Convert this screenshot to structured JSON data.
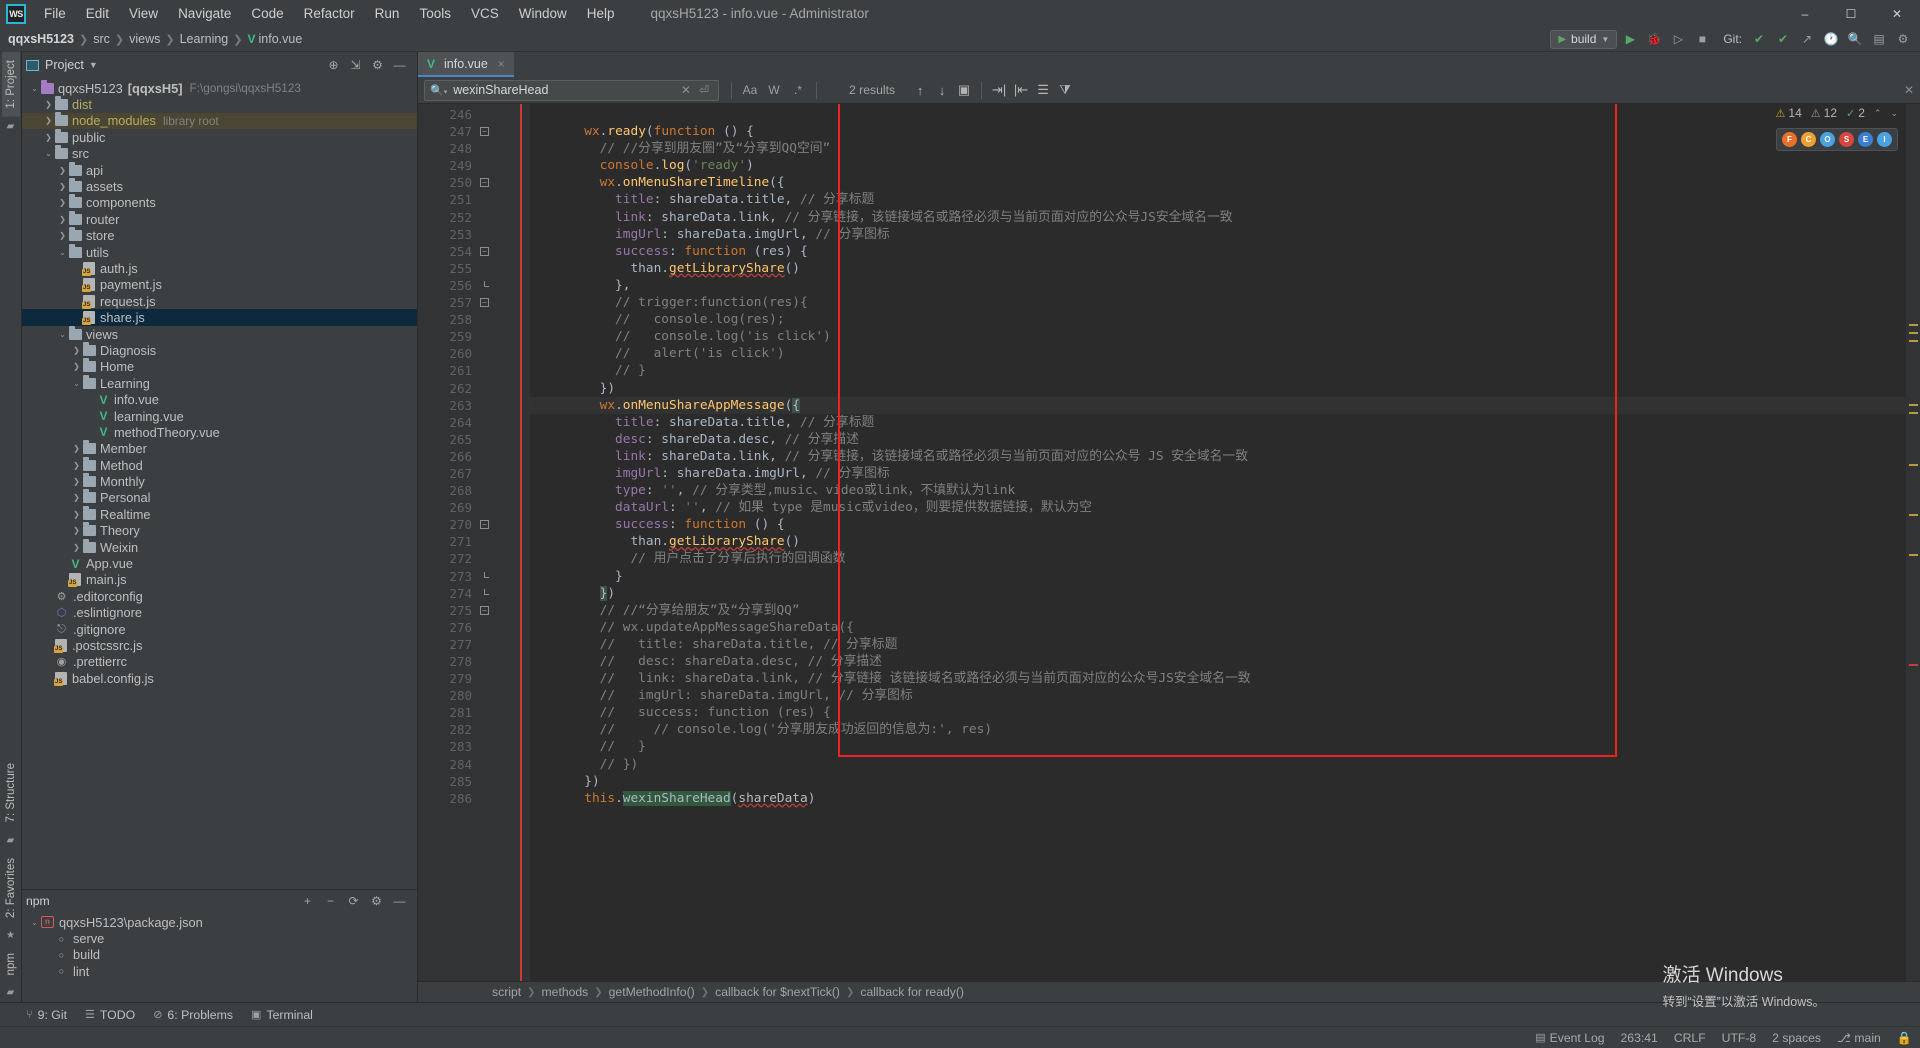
{
  "titlebar": {
    "logo": "WS",
    "title": "qqxsH5123 - info.vue - Administrator",
    "menus": [
      "File",
      "Edit",
      "View",
      "Navigate",
      "Code",
      "Refactor",
      "Run",
      "Tools",
      "VCS",
      "Window",
      "Help"
    ],
    "minimize": "–",
    "maximize": "☐",
    "close": "✕"
  },
  "navbar": {
    "crumbs": [
      "qqxsH5123",
      "src",
      "views",
      "Learning",
      "info.vue"
    ],
    "run_config": "build",
    "git_label": "Git:",
    "icons": [
      "run-icon",
      "debug-icon",
      "coverage-icon",
      "stop-icon",
      "check-icon",
      "check2-icon",
      "update-icon",
      "history-icon",
      "search-everywhere-icon",
      "settings-icon"
    ]
  },
  "left_strip": {
    "top_tab": "1: Project",
    "structure_tab": "7: Structure",
    "favorites_tab": "2: Favorites",
    "npm_tab": "npm"
  },
  "project_panel": {
    "title": "Project",
    "actions": [
      "locate-icon",
      "collapse-all-icon",
      "settings-icon",
      "hide-icon"
    ],
    "tree": [
      {
        "depth": 0,
        "arrow": "down",
        "icon": "folder-purple",
        "label": "qqxsH5123",
        "bold": "[qqxsH5]",
        "dim": "F:\\gongsi\\qqxsH5123"
      },
      {
        "depth": 1,
        "arrow": "right",
        "icon": "folder",
        "label": "dist",
        "yellow": true
      },
      {
        "depth": 1,
        "arrow": "right",
        "icon": "folder",
        "label": "node_modules",
        "yellow": true,
        "dim": "library root",
        "hl": true
      },
      {
        "depth": 1,
        "arrow": "right",
        "icon": "folder",
        "label": "public"
      },
      {
        "depth": 1,
        "arrow": "down",
        "icon": "folder",
        "label": "src"
      },
      {
        "depth": 2,
        "arrow": "right",
        "icon": "folder",
        "label": "api"
      },
      {
        "depth": 2,
        "arrow": "right",
        "icon": "folder",
        "label": "assets"
      },
      {
        "depth": 2,
        "arrow": "right",
        "icon": "folder",
        "label": "components"
      },
      {
        "depth": 2,
        "arrow": "right",
        "icon": "folder",
        "label": "router"
      },
      {
        "depth": 2,
        "arrow": "right",
        "icon": "folder",
        "label": "store"
      },
      {
        "depth": 2,
        "arrow": "down",
        "icon": "folder",
        "label": "utils"
      },
      {
        "depth": 3,
        "arrow": "none",
        "icon": "js",
        "label": "auth.js"
      },
      {
        "depth": 3,
        "arrow": "none",
        "icon": "js",
        "label": "payment.js"
      },
      {
        "depth": 3,
        "arrow": "none",
        "icon": "js",
        "label": "request.js"
      },
      {
        "depth": 3,
        "arrow": "none",
        "icon": "js",
        "label": "share.js",
        "selected": true
      },
      {
        "depth": 2,
        "arrow": "down",
        "icon": "folder",
        "label": "views"
      },
      {
        "depth": 3,
        "arrow": "right",
        "icon": "folder",
        "label": "Diagnosis"
      },
      {
        "depth": 3,
        "arrow": "right",
        "icon": "folder",
        "label": "Home"
      },
      {
        "depth": 3,
        "arrow": "down",
        "icon": "folder",
        "label": "Learning"
      },
      {
        "depth": 4,
        "arrow": "none",
        "icon": "vue",
        "label": "info.vue"
      },
      {
        "depth": 4,
        "arrow": "none",
        "icon": "vue",
        "label": "learning.vue"
      },
      {
        "depth": 4,
        "arrow": "none",
        "icon": "vue",
        "label": "methodTheory.vue"
      },
      {
        "depth": 3,
        "arrow": "right",
        "icon": "folder",
        "label": "Member"
      },
      {
        "depth": 3,
        "arrow": "right",
        "icon": "folder",
        "label": "Method"
      },
      {
        "depth": 3,
        "arrow": "right",
        "icon": "folder",
        "label": "Monthly"
      },
      {
        "depth": 3,
        "arrow": "right",
        "icon": "folder",
        "label": "Personal"
      },
      {
        "depth": 3,
        "arrow": "right",
        "icon": "folder",
        "label": "Realtime"
      },
      {
        "depth": 3,
        "arrow": "right",
        "icon": "folder",
        "label": "Theory"
      },
      {
        "depth": 3,
        "arrow": "right",
        "icon": "folder",
        "label": "Weixin"
      },
      {
        "depth": 2,
        "arrow": "none",
        "icon": "vue",
        "label": "App.vue"
      },
      {
        "depth": 2,
        "arrow": "none",
        "icon": "js",
        "label": "main.js"
      },
      {
        "depth": 1,
        "arrow": "none",
        "icon": "gear",
        "label": ".editorconfig"
      },
      {
        "depth": 1,
        "arrow": "none",
        "icon": "eslint",
        "label": ".eslintignore"
      },
      {
        "depth": 1,
        "arrow": "none",
        "icon": "git",
        "label": ".gitignore"
      },
      {
        "depth": 1,
        "arrow": "none",
        "icon": "js",
        "label": ".postcssrc.js"
      },
      {
        "depth": 1,
        "arrow": "none",
        "icon": "prettier",
        "label": ".prettierrc"
      },
      {
        "depth": 1,
        "arrow": "none",
        "icon": "js",
        "label": "babel.config.js"
      }
    ]
  },
  "npm_panel": {
    "title": "npm",
    "actions": [
      "add-icon",
      "remove-icon",
      "refresh-icon",
      "settings-icon",
      "hide-icon"
    ],
    "tree": [
      {
        "depth": 0,
        "arrow": "down",
        "icon": "package",
        "label": "qqxsH5123\\package.json"
      },
      {
        "depth": 1,
        "arrow": "none",
        "icon": "script",
        "label": "serve"
      },
      {
        "depth": 1,
        "arrow": "none",
        "icon": "script",
        "label": "build"
      },
      {
        "depth": 1,
        "arrow": "none",
        "icon": "script",
        "label": "lint"
      }
    ]
  },
  "editor": {
    "tab": {
      "label": "info.vue",
      "close": "×",
      "icon": "vue-icon"
    },
    "find": {
      "value": "wexinShareHead",
      "results": "2 results",
      "options": [
        "Aa",
        "W",
        ".*"
      ],
      "icons": [
        "search-icon",
        "clear-icon",
        "history-icon",
        "prev-match-icon",
        "next-match-icon",
        "select-all-icon",
        "filter-icon",
        "new-line-icon",
        "preserve-case-icon",
        "sort-icon"
      ]
    },
    "inspections": {
      "warnings": "14",
      "weak_warnings": "12",
      "typos": "2"
    },
    "browsers": [
      "firefox-icon",
      "chrome-icon",
      "opera-icon",
      "safari-icon",
      "edge-icon",
      "explorer-icon"
    ],
    "breadcrumbs": [
      "script",
      "methods",
      "getMethodInfo()",
      "callback for $nextTick()",
      "callback for ready()"
    ],
    "first_line": 246,
    "lines": [
      {
        "n": 246,
        "fold": "",
        "html": ""
      },
      {
        "n": 247,
        "fold": "minus",
        "html": "      <span class='k'>wx</span><span class='pl'>.</span><span class='fn'>ready</span><span class='pl'>(</span><span class='k'>function</span> <span class='pl'>() {</span>"
      },
      {
        "n": 248,
        "fold": "",
        "html": "        <span class='cm'>// //分享到朋友圈”及“分享到QQ空间”</span>"
      },
      {
        "n": 249,
        "fold": "",
        "html": "        <span class='k'>console</span><span class='pl'>.</span><span class='fn'>log</span><span class='pl'>(</span><span class='st'>'ready'</span><span class='pl'>)</span>"
      },
      {
        "n": 250,
        "fold": "minus",
        "html": "        <span class='k'>wx</span><span class='pl'>.</span><span class='fn'>onMenuShareTimeline</span><span class='pl'>({</span>"
      },
      {
        "n": 251,
        "fold": "",
        "html": "          <span class='pr'>title</span><span class='pl'>: shareData.title,</span> <span class='cm'>// 分享标题</span>"
      },
      {
        "n": 252,
        "fold": "",
        "html": "          <span class='pr'>link</span><span class='pl'>: shareData.link,</span> <span class='cm'>// 分享链接，该链接域名或路径必须与当前页面对应的公众号JS安全域名一致</span>"
      },
      {
        "n": 253,
        "fold": "",
        "html": "          <span class='pr'>imgUrl</span><span class='pl'>: shareData.imgUrl,</span> <span class='cm'>// 分享图标</span>"
      },
      {
        "n": 254,
        "fold": "minus",
        "html": "          <span class='pr'>success</span><span class='pl'>: </span><span class='k'>function</span> <span class='pl'>(res) {</span>"
      },
      {
        "n": 255,
        "fold": "",
        "html": "            <span class='pl'>than.</span><span class='ul err'>getLibraryShare</span><span class='pl'>()</span>"
      },
      {
        "n": 256,
        "fold": "end",
        "html": "          <span class='pl'>},</span>"
      },
      {
        "n": 257,
        "fold": "minus",
        "html": "          <span class='cm'>// trigger:function(res){</span>"
      },
      {
        "n": 258,
        "fold": "",
        "html": "          <span class='cm'>//   console.log(res);</span>"
      },
      {
        "n": 259,
        "fold": "",
        "html": "          <span class='cm'>//   console.log('is click')</span>"
      },
      {
        "n": 260,
        "fold": "",
        "html": "          <span class='cm'>//   alert('is click')</span>"
      },
      {
        "n": 261,
        "fold": "",
        "html": "          <span class='cm'>// }</span>"
      },
      {
        "n": 262,
        "fold": "",
        "html": "        <span class='pl'>})</span>"
      },
      {
        "n": 263,
        "fold": "",
        "html": "        <span class='k'>wx</span><span class='pl'>.</span><span class='fn'>onMenuShareAppMessage</span><span class='pl'>(</span><span class='brace-hl'>{</span>",
        "current": true
      },
      {
        "n": 264,
        "fold": "",
        "html": "          <span class='pr'>title</span><span class='pl'>: shareData.title,</span> <span class='cm'>// 分享标题</span>"
      },
      {
        "n": 265,
        "fold": "",
        "html": "          <span class='pr'>desc</span><span class='pl'>: shareData.desc,</span> <span class='cm'>// 分享描述</span>"
      },
      {
        "n": 266,
        "fold": "",
        "html": "          <span class='pr'>link</span><span class='pl'>: shareData.link,</span> <span class='cm'>// 分享链接，该链接域名或路径必须与当前页面对应的公众号 JS 安全域名一致</span>"
      },
      {
        "n": 267,
        "fold": "",
        "html": "          <span class='pr'>imgUrl</span><span class='pl'>: shareData.imgUrl,</span> <span class='cm'>// 分享图标</span>"
      },
      {
        "n": 268,
        "fold": "",
        "html": "          <span class='pr'>type</span><span class='pl'>: </span><span class='st'>''</span><span class='pl'>,</span> <span class='cm'>// 分享类型,music、video或link，不填默认为link</span>"
      },
      {
        "n": 269,
        "fold": "",
        "html": "          <span class='pr'>dataUrl</span><span class='pl'>: </span><span class='st'>''</span><span class='pl'>,</span> <span class='cm'>// 如果 type 是music或video，则要提供数据链接，默认为空</span>"
      },
      {
        "n": 270,
        "fold": "minus",
        "html": "          <span class='pr'>success</span><span class='pl'>: </span><span class='k'>function</span> <span class='pl'>() {</span>"
      },
      {
        "n": 271,
        "fold": "",
        "html": "            <span class='pl'>than.</span><span class='ul err'>getLibraryShare</span><span class='pl'>()</span>"
      },
      {
        "n": 272,
        "fold": "",
        "html": "            <span class='cm'>// 用户点击了分享后执行的回调函数</span>"
      },
      {
        "n": 273,
        "fold": "end",
        "html": "          <span class='pl'>}</span>"
      },
      {
        "n": 274,
        "fold": "end",
        "html": "        <span class='brace-hl'>}</span><span class='pl'>)</span>"
      },
      {
        "n": 275,
        "fold": "minus",
        "html": "        <span class='cm'>// //“分享给朋友”及“分享到QQ”</span>"
      },
      {
        "n": 276,
        "fold": "",
        "html": "        <span class='cm'>// wx.updateAppMessageShareData({</span>"
      },
      {
        "n": 277,
        "fold": "",
        "html": "        <span class='cm'>//   title: shareData.title, // 分享标题</span>"
      },
      {
        "n": 278,
        "fold": "",
        "html": "        <span class='cm'>//   desc: shareData.desc, // 分享描述</span>"
      },
      {
        "n": 279,
        "fold": "",
        "html": "        <span class='cm'>//   link: shareData.link, // 分享链接 该链接域名或路径必须与当前页面对应的公众号JS安全域名一致</span>"
      },
      {
        "n": 280,
        "fold": "",
        "html": "        <span class='cm'>//   imgUrl: shareData.imgUrl, // 分享图标</span>"
      },
      {
        "n": 281,
        "fold": "",
        "html": "        <span class='cm'>//   success: function (res) {</span>"
      },
      {
        "n": 282,
        "fold": "",
        "html": "        <span class='cm'>//     // console.log('分享朋友成功返回的信息为:', res)</span>"
      },
      {
        "n": 283,
        "fold": "",
        "html": "        <span class='cm'>//   }</span>"
      },
      {
        "n": 284,
        "fold": "",
        "html": "        <span class='cm'>// })</span>"
      },
      {
        "n": 285,
        "fold": "",
        "html": "      <span class='pl'>})</span>"
      },
      {
        "n": 286,
        "fold": "",
        "html": "      <span class='k'>this</span><span class='pl'>.</span><span class='hlmatch'>wexinShareHead</span><span class='pl'>(</span><span class='err'>shareData</span><span class='pl'>)</span>"
      }
    ]
  },
  "bottombar": {
    "items": [
      {
        "icon": "git-icon",
        "label": "9: Git"
      },
      {
        "icon": "todo-icon",
        "label": "TODO"
      },
      {
        "icon": "problems-icon",
        "label": "6: Problems"
      },
      {
        "icon": "terminal-icon",
        "label": "Terminal"
      }
    ]
  },
  "statusbar": {
    "event_log": "Event Log",
    "caret": "263:41",
    "line_sep": "CRLF",
    "encoding": "UTF-8",
    "indent": "2 spaces",
    "branch": "⎇ main",
    "lock": "lock-icon"
  },
  "watermark": {
    "line1": "激活 Windows",
    "line2": "转到“设置”以激活 Windows。"
  }
}
